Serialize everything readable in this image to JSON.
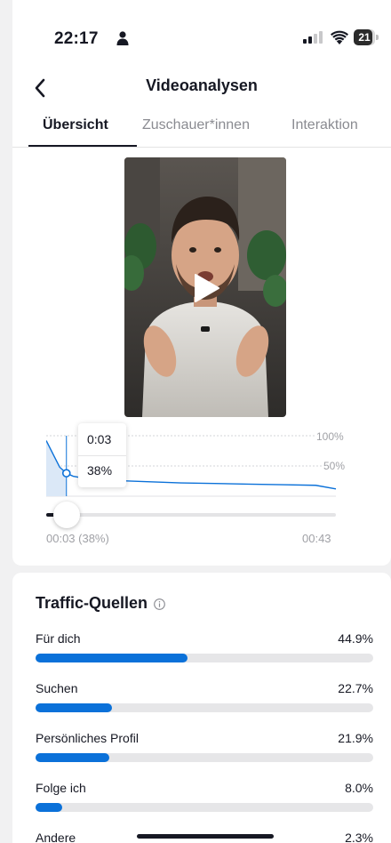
{
  "status_bar": {
    "time": "22:17",
    "battery": "21"
  },
  "header": {
    "title": "Videoanalysen"
  },
  "tabs": [
    {
      "label": "Übersicht",
      "active": true
    },
    {
      "label": "Zuschauer*innen",
      "active": false
    },
    {
      "label": "Interaktion",
      "active": false
    }
  ],
  "retention": {
    "y_labels": [
      "100%",
      "50%"
    ],
    "tooltip_time": "0:03",
    "tooltip_value": "38%",
    "chart_data": {
      "type": "area",
      "x": [
        0,
        1,
        2,
        3,
        4,
        6,
        8,
        10,
        15,
        20,
        25,
        30,
        35,
        40,
        43
      ],
      "y": [
        92,
        70,
        48,
        38,
        33,
        29,
        27,
        26,
        24,
        22,
        21,
        20,
        19,
        18,
        12
      ],
      "xlim": [
        0,
        43
      ],
      "ylim": [
        0,
        100
      ],
      "marker_x": 3,
      "marker_y": 38
    },
    "slider": {
      "position_fraction": 0.07,
      "current_label": "00:03 (38%)",
      "end_label": "00:43"
    }
  },
  "traffic": {
    "title": "Traffic-Quellen",
    "accent": "#0b71d9",
    "sources": [
      {
        "label": "Für dich",
        "percent": "44.9%",
        "value": 44.9
      },
      {
        "label": "Suchen",
        "percent": "22.7%",
        "value": 22.7
      },
      {
        "label": "Persönliches Profil",
        "percent": "21.9%",
        "value": 21.9
      },
      {
        "label": "Folge ich",
        "percent": "8.0%",
        "value": 8.0
      },
      {
        "label": "Andere",
        "percent": "2.3%",
        "value": 2.3
      }
    ]
  }
}
